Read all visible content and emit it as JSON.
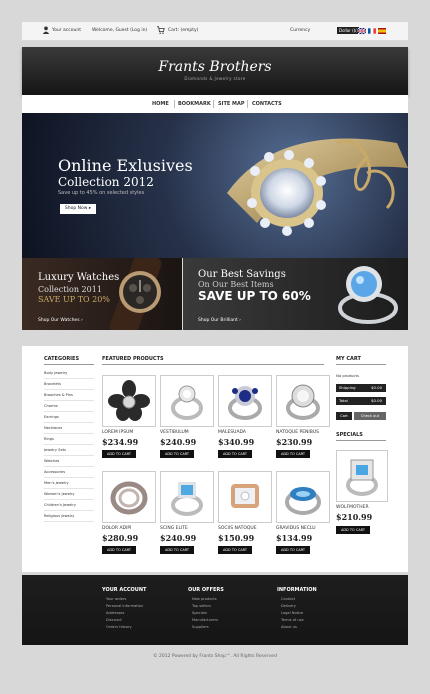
{
  "util": {
    "account": "Your account",
    "welcome": "Welcome, Guest (Log in)",
    "cart": "Cart: (empty)",
    "currency_label": "Currency",
    "currency_value": "Dollar ($)"
  },
  "brand": {
    "name": "Frants Brothers",
    "tagline": "Diamonds & Jewelry store"
  },
  "nav": {
    "items": [
      "HOME",
      "BOOKMARK",
      "SITE MAP",
      "CONTACTS"
    ]
  },
  "hero": {
    "line1": "Online Exlusives",
    "line2": "Collection 2012",
    "line3": "Save up to 45% on selected styles",
    "button": "Shop Now ▸"
  },
  "promo1": {
    "line1": "Luxury Watches",
    "line2": "Collection 2011",
    "line3": "SAVE UP TO 20%",
    "link": "Shop Our Watches ›"
  },
  "promo2": {
    "line1": "Our Best Savings",
    "line2": "On Our Best Items",
    "line3": "SAVE UP TO 60%",
    "link": "Shop Our Brilliant ›"
  },
  "categories": {
    "title": "CATEGORIES",
    "items": [
      "Body Jewelry",
      "Bracelets",
      "Brooches & Pins",
      "Charms",
      "Earrings",
      "Necklaces",
      "Rings",
      "Jewelry Sets",
      "Watches",
      "Accessories",
      "Men's Jewelry",
      "Women's Jewelry",
      "Children's Jewelry",
      "Religious Jewelry"
    ]
  },
  "featured": {
    "title": "FEATURED PRODUCTS",
    "add_label": "ADD TO CART",
    "products": [
      {
        "name": "LOREM IPSUM",
        "price": "$234.99"
      },
      {
        "name": "VESTIBULUM",
        "price": "$240.99"
      },
      {
        "name": "MALESUADA",
        "price": "$340.99"
      },
      {
        "name": "NATOQUE PENIBUS",
        "price": "$230.99"
      },
      {
        "name": "DOLOR ADIPI",
        "price": "$280.99"
      },
      {
        "name": "SCING ELITE",
        "price": "$240.99"
      },
      {
        "name": "SOCIIS NATOQUE",
        "price": "$150.99"
      },
      {
        "name": "GRAVIDUS NECLU",
        "price": "$134.99"
      }
    ]
  },
  "cart": {
    "title": "MY CART",
    "empty": "No products",
    "shipping_label": "Shipping",
    "shipping_value": "$0.00",
    "total_label": "Total",
    "total_value": "$0.00",
    "cart_button": "Cart",
    "checkout_button": "Check out"
  },
  "specials": {
    "title": "SPECIALS",
    "name": "WOLFMOTHER",
    "price": "$210.99",
    "add_label": "ADD TO CART"
  },
  "footer": {
    "account_title": "YOUR ACCOUNT",
    "account_links": [
      "Your orders",
      "Personal information",
      "Addresses",
      "Discount",
      "Orders history"
    ],
    "offers_title": "OUR OFFERS",
    "offers_links": [
      "New products",
      "Top sellers",
      "Specials",
      "Manufacturers",
      "Suppliers"
    ],
    "info_title": "INFORMATION",
    "info_links": [
      "Contact",
      "Delivery",
      "Legal Notice",
      "Terms of use",
      "About us"
    ]
  },
  "copyright": "© 2012 Powered by Frants Shop™. All Rights Reserved"
}
